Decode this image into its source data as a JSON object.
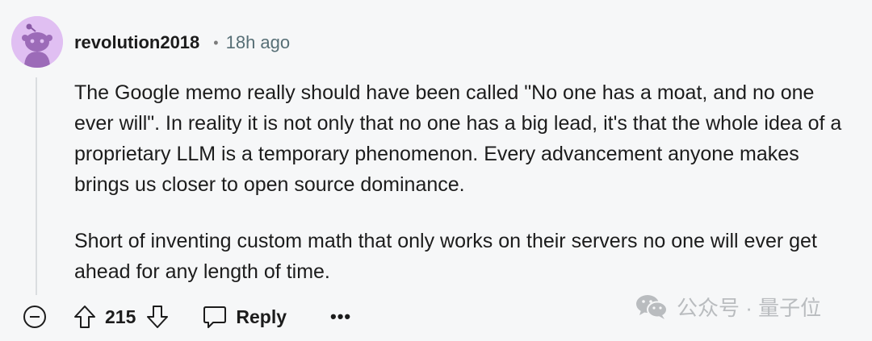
{
  "comment": {
    "username": "revolution2018",
    "separator": "•",
    "time_ago": "18h ago",
    "paragraphs": [
      "The Google memo really should have been called \"No one has a moat, and no one ever will\". In reality it is not only that no one has a big lead, it's that the whole idea of a proprietary LLM is a temporary phenomenon. Every advancement anyone makes brings us closer to open source dominance.",
      "Short of inventing custom math that only works on their servers no one will ever get ahead for any length of time."
    ]
  },
  "actions": {
    "score": "215",
    "reply_label": "Reply",
    "more_label": "•••"
  },
  "watermark": {
    "text": "公众号 · 量子位",
    "icon": "wechat-icon"
  },
  "colors": {
    "background": "#f6f7f8",
    "avatar_bg": "#e0bff2",
    "avatar_fg": "#9c6bb8",
    "text": "#1c1c1c",
    "meta": "#576f76"
  }
}
